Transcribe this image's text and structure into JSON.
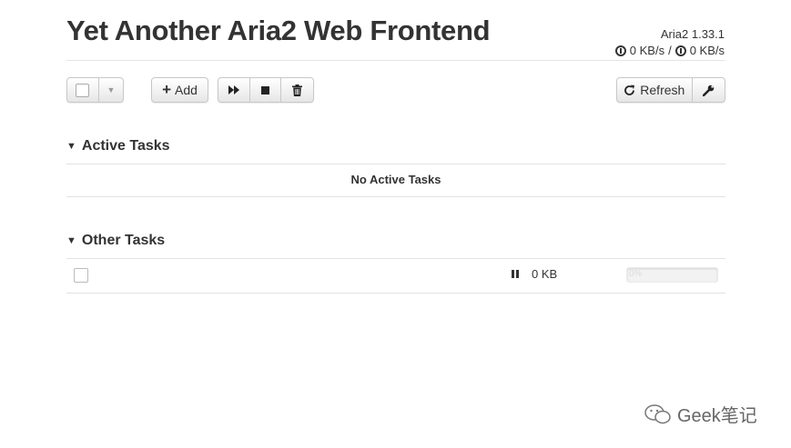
{
  "app": {
    "title": "Yet Another Aria2 Web Frontend",
    "version": "Aria2 1.33.1",
    "download_speed": "0 KB/s",
    "speed_separator": "/",
    "upload_speed": "0 KB/s"
  },
  "toolbar": {
    "add_label": "Add",
    "refresh_label": "Refresh"
  },
  "active_section": {
    "title": "Active Tasks",
    "empty_text": "No Active Tasks"
  },
  "other_section": {
    "title": "Other Tasks",
    "tasks": [
      {
        "size": "0 KB",
        "progress_label": "0%",
        "progress": 0,
        "status": "paused"
      }
    ]
  },
  "watermark": "Geek笔记"
}
